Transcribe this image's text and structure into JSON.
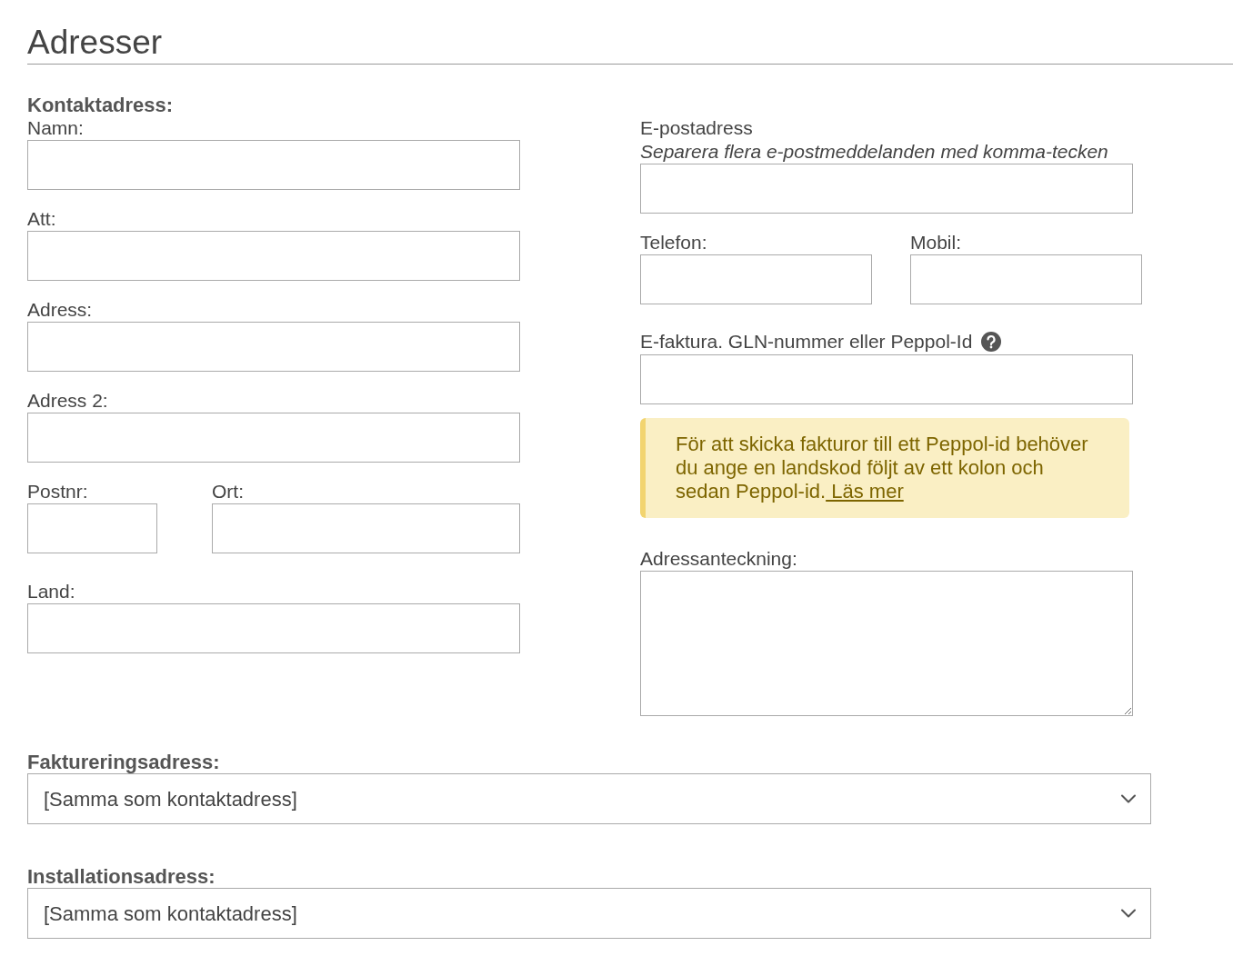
{
  "title": "Adresser",
  "contact": {
    "heading": "Kontaktadress:",
    "fields": [
      {
        "label": "Namn:",
        "kind": "text"
      },
      {
        "label": "Att:",
        "kind": "text"
      },
      {
        "label": "Adress:",
        "kind": "text"
      },
      {
        "label": "Adress 2:",
        "kind": "text"
      }
    ],
    "postal": [
      {
        "label": "Postnr:",
        "kind": "short"
      },
      {
        "label": "Ort:",
        "kind": "wide"
      }
    ],
    "country": {
      "label": "Land:"
    }
  },
  "email": {
    "label": "E-postadress",
    "hint": "Separera flera e-postmeddelanden med komma-tecken"
  },
  "phones": [
    {
      "label": "Telefon:"
    },
    {
      "label": "Mobil:"
    }
  ],
  "einvoice": {
    "label": "E-faktura. GLN-nummer eller Peppol-Id"
  },
  "notice": {
    "text": "För att skicka fakturor till ett Peppol-id behöver du ange en landskod följt av ett kolon och sedan Peppol-id.",
    "link": " Läs mer"
  },
  "note": {
    "label": "Adressanteckning:"
  },
  "selects": [
    {
      "heading": "Faktureringsadress:",
      "value": "[Samma som kontaktadress]"
    },
    {
      "heading": "Installationsadress:",
      "value": "[Samma som kontaktadress]"
    }
  ]
}
